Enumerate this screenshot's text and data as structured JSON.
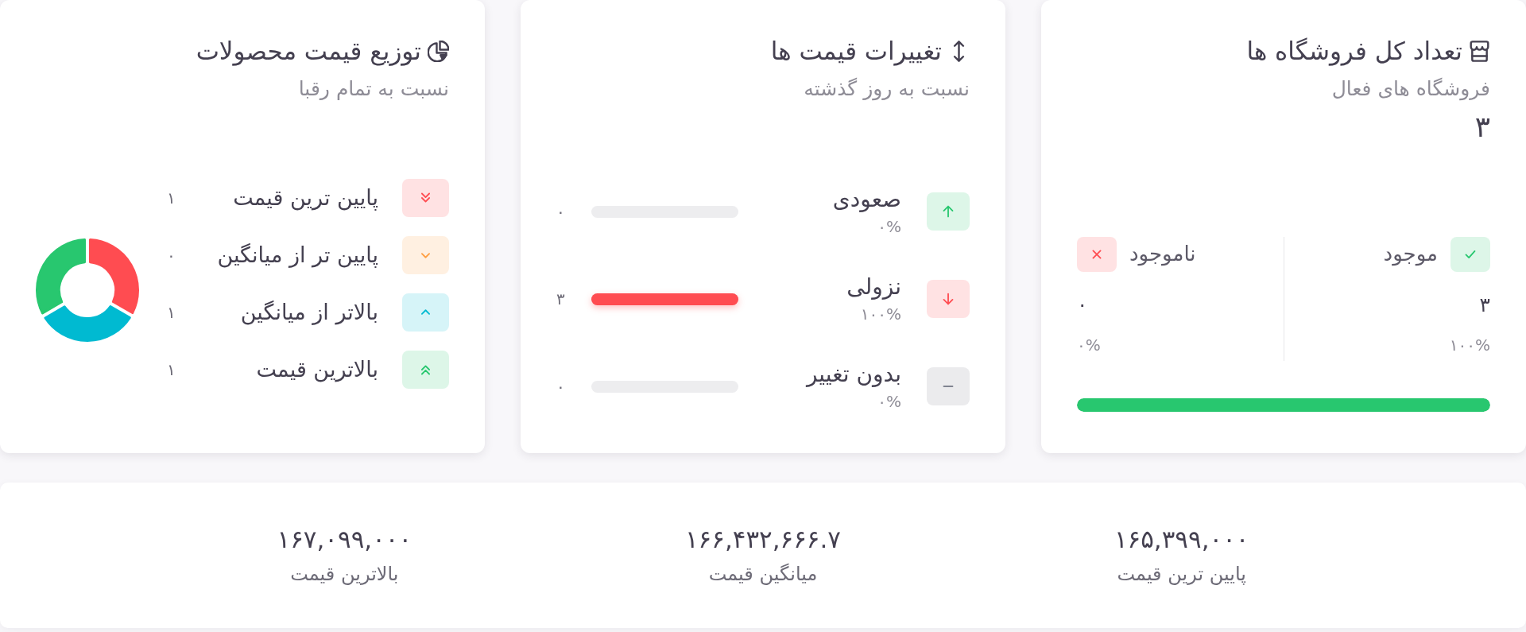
{
  "stores": {
    "title": "تعداد کل فروشگاه ها",
    "subtitle": "فروشگاه های فعال",
    "total": "۳",
    "stats": [
      {
        "kind": "available",
        "label": "موجود",
        "value": "۳",
        "percent": "۱۰۰%"
      },
      {
        "kind": "unavailable",
        "label": "ناموجود",
        "value": "۰",
        "percent": "۰%"
      }
    ],
    "progress": {
      "level": 1
    }
  },
  "price_changes": {
    "title": "تغییرات قیمت ها",
    "subtitle": "نسبت به روز گذشته",
    "rows": [
      {
        "kind": "rise",
        "label": "صعودی",
        "percent": "۰%",
        "count": "۰"
      },
      {
        "kind": "fall",
        "label": "نزولی",
        "percent": "۱۰۰%",
        "count": "۳",
        "level": 1
      },
      {
        "kind": "flat",
        "label": "بدون تغییر",
        "percent": "۰%",
        "count": "۰"
      }
    ]
  },
  "price_distribution": {
    "title": "توزیع قیمت محصولات",
    "subtitle": "نسبت به تمام رقبا",
    "legend": [
      {
        "kind": "lowest",
        "label": "پایین ترین قیمت",
        "count": "۱"
      },
      {
        "kind": "below_average",
        "label": "پایین تر از میانگین",
        "count": "۰"
      },
      {
        "kind": "above_average",
        "label": "بالاتر از میانگین",
        "count": "۱"
      },
      {
        "kind": "highest",
        "label": "بالاترین قیمت",
        "count": "۱"
      }
    ],
    "chart_data": {
      "type": "donut",
      "values": [
        33.3,
        0,
        33.3,
        33.4
      ]
    }
  },
  "price_summary": [
    {
      "value": "۱۶۵,۳۹۹,۰۰۰",
      "label": "پایین ترین قیمت"
    },
    {
      "value": "۱۶۶,۴۳۲,۶۶۶.۷",
      "label": "میانگین قیمت"
    },
    {
      "value": "۱۶۷,۰۹۹,۰۰۰",
      "label": "بالاترین قیمت"
    }
  ]
}
